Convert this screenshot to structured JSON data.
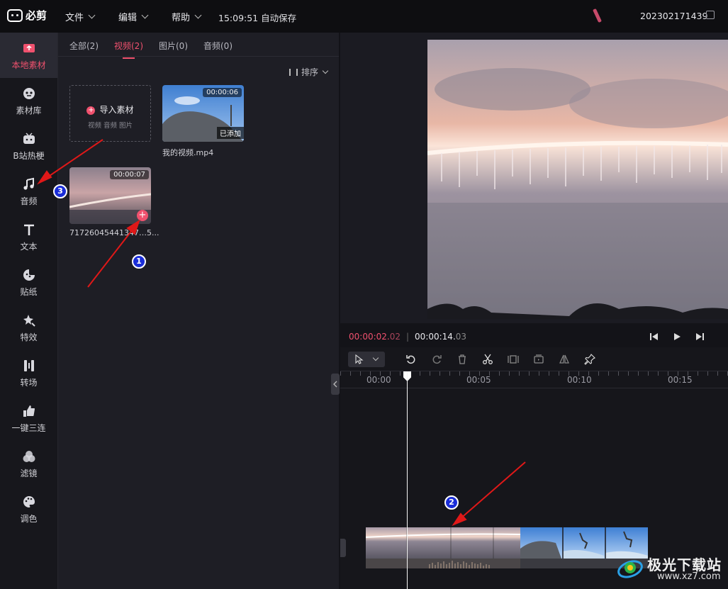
{
  "app": {
    "name": "必剪",
    "autosave": "15:09:51 自动保存",
    "project": "202302171439"
  },
  "menu": [
    {
      "label": "文件"
    },
    {
      "label": "编辑"
    },
    {
      "label": "帮助"
    }
  ],
  "sidebar": {
    "items": [
      {
        "label": "本地素材",
        "icon": "upload-folder-icon"
      },
      {
        "label": "素材库",
        "icon": "library-icon"
      },
      {
        "label": "B站热梗",
        "icon": "bilibili-tv-icon"
      },
      {
        "label": "音频",
        "icon": "music-note-icon"
      },
      {
        "label": "文本",
        "icon": "text-t-icon"
      },
      {
        "label": "贴纸",
        "icon": "sticker-icon"
      },
      {
        "label": "特效",
        "icon": "star-effect-icon"
      },
      {
        "label": "转场",
        "icon": "transition-icon"
      },
      {
        "label": "一键三连",
        "icon": "thumbs-up-icon"
      },
      {
        "label": "滤镜",
        "icon": "filter-circles-icon"
      },
      {
        "label": "调色",
        "icon": "palette-icon"
      }
    ]
  },
  "media": {
    "tabs": [
      {
        "label": "全部(2)"
      },
      {
        "label": "视频(2)"
      },
      {
        "label": "图片(0)"
      },
      {
        "label": "音频(0)"
      }
    ],
    "sort_label": "排序",
    "import": {
      "label": "导入素材",
      "sub": "视频  音频  图片"
    },
    "items": [
      {
        "name": "我的视频.mp4",
        "duration": "00:00:06",
        "status": "已添加"
      },
      {
        "name": "71726045441347…5...",
        "duration": "00:00:07"
      }
    ]
  },
  "player": {
    "current_main": "00:00:02.",
    "current_frac": "02",
    "total_main": "00:00:14.",
    "total_frac": "03"
  },
  "ruler": [
    "00:00",
    "00:05",
    "00:10",
    "00:15"
  ],
  "annotations": [
    "1",
    "2",
    "3"
  ],
  "watermark": {
    "text": "极光下载站",
    "url": "www.xz7.com"
  },
  "colors": {
    "accent": "#f0516e",
    "badge": "#1a2dd8",
    "arrow": "#e01818"
  }
}
